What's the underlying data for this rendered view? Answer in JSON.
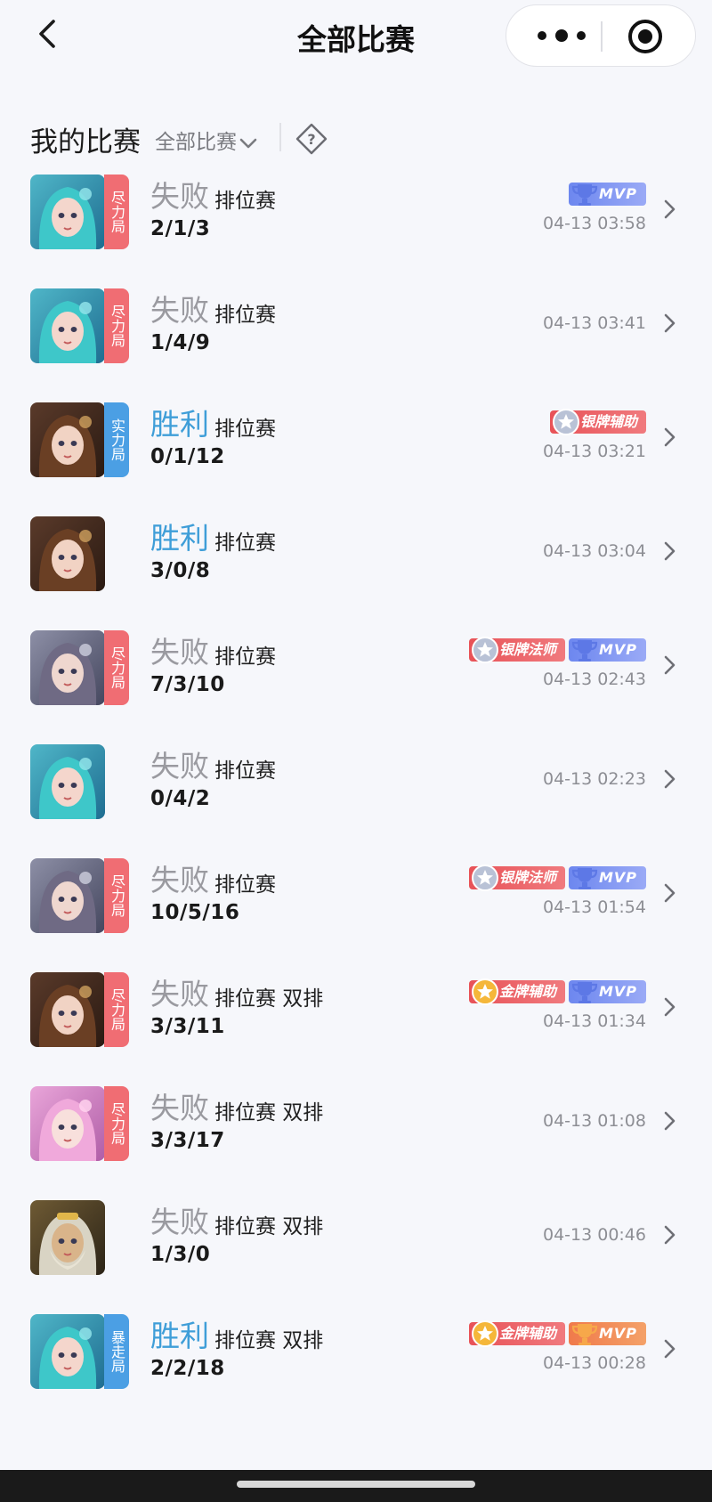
{
  "header": {
    "title": "全部比赛",
    "back_icon": "chevron-left-icon",
    "more_icon": "more-dots-icon",
    "record_icon": "record-target-icon"
  },
  "filter": {
    "label": "我的比赛",
    "dropdown_value": "全部比赛",
    "help_icon": "question-diamond-icon"
  },
  "colors": {
    "lose": "#9a9aa0",
    "win": "#3f9ed8",
    "tag_red": "#f06d73",
    "tag_blue": "#4b9fe4",
    "mvp_blue": "#6d87ef",
    "mvp_gold": "#f07a4b",
    "badge_red": "#e85257"
  },
  "matches": [
    {
      "result": "失败",
      "outcome": "lose",
      "mode": "排位赛",
      "kda": "2/1/3",
      "tag": "尽力局",
      "tag_color": "red",
      "hero": "mermaid",
      "badges": [
        {
          "kind": "mvp",
          "label": "MVP"
        }
      ],
      "time": "04-13 03:58"
    },
    {
      "result": "失败",
      "outcome": "lose",
      "mode": "排位赛",
      "kda": "1/4/9",
      "tag": "尽力局",
      "tag_color": "red",
      "hero": "mermaid",
      "badges": [],
      "time": "04-13 03:41"
    },
    {
      "result": "胜利",
      "outcome": "win",
      "mode": "排位赛",
      "kda": "0/1/12",
      "tag": "实力局",
      "tag_color": "blue",
      "hero": "brunette",
      "badges": [
        {
          "kind": "silver",
          "label": "银牌辅助"
        }
      ],
      "time": "04-13 03:21"
    },
    {
      "result": "胜利",
      "outcome": "win",
      "mode": "排位赛",
      "kda": "3/0/8",
      "tag": "",
      "tag_color": "",
      "hero": "brunette",
      "badges": [],
      "time": "04-13 03:04"
    },
    {
      "result": "失败",
      "outcome": "lose",
      "mode": "排位赛",
      "kda": "7/3/10",
      "tag": "尽力局",
      "tag_color": "red",
      "hero": "silverhair",
      "badges": [
        {
          "kind": "silver",
          "label": "银牌法师"
        },
        {
          "kind": "mvp",
          "label": "MVP"
        }
      ],
      "time": "04-13 02:43"
    },
    {
      "result": "失败",
      "outcome": "lose",
      "mode": "排位赛",
      "kda": "0/4/2",
      "tag": "",
      "tag_color": "",
      "hero": "mermaid",
      "badges": [],
      "time": "04-13 02:23"
    },
    {
      "result": "失败",
      "outcome": "lose",
      "mode": "排位赛",
      "kda": "10/5/16",
      "tag": "尽力局",
      "tag_color": "red",
      "hero": "silverhair",
      "badges": [
        {
          "kind": "silver",
          "label": "银牌法师"
        },
        {
          "kind": "mvp",
          "label": "MVP"
        }
      ],
      "time": "04-13 01:54"
    },
    {
      "result": "失败",
      "outcome": "lose",
      "mode": "排位赛 双排",
      "kda": "3/3/11",
      "tag": "尽力局",
      "tag_color": "red",
      "hero": "brunette",
      "badges": [
        {
          "kind": "gold",
          "label": "金牌辅助"
        },
        {
          "kind": "mvp",
          "label": "MVP"
        }
      ],
      "time": "04-13 01:34"
    },
    {
      "result": "失败",
      "outcome": "lose",
      "mode": "排位赛 双排",
      "kda": "3/3/17",
      "tag": "尽力局",
      "tag_color": "red",
      "hero": "pinkhair",
      "badges": [],
      "time": "04-13 01:08"
    },
    {
      "result": "失败",
      "outcome": "lose",
      "mode": "排位赛 双排",
      "kda": "1/3/0",
      "tag": "",
      "tag_color": "",
      "hero": "oldman",
      "badges": [],
      "time": "04-13 00:46"
    },
    {
      "result": "胜利",
      "outcome": "win",
      "mode": "排位赛 双排",
      "kda": "2/2/18",
      "tag": "暴走局",
      "tag_color": "blue",
      "hero": "mermaid",
      "badges": [
        {
          "kind": "gold",
          "label": "金牌辅助"
        },
        {
          "kind": "mvp-gold",
          "label": "MVP"
        }
      ],
      "time": "04-13 00:28"
    }
  ]
}
